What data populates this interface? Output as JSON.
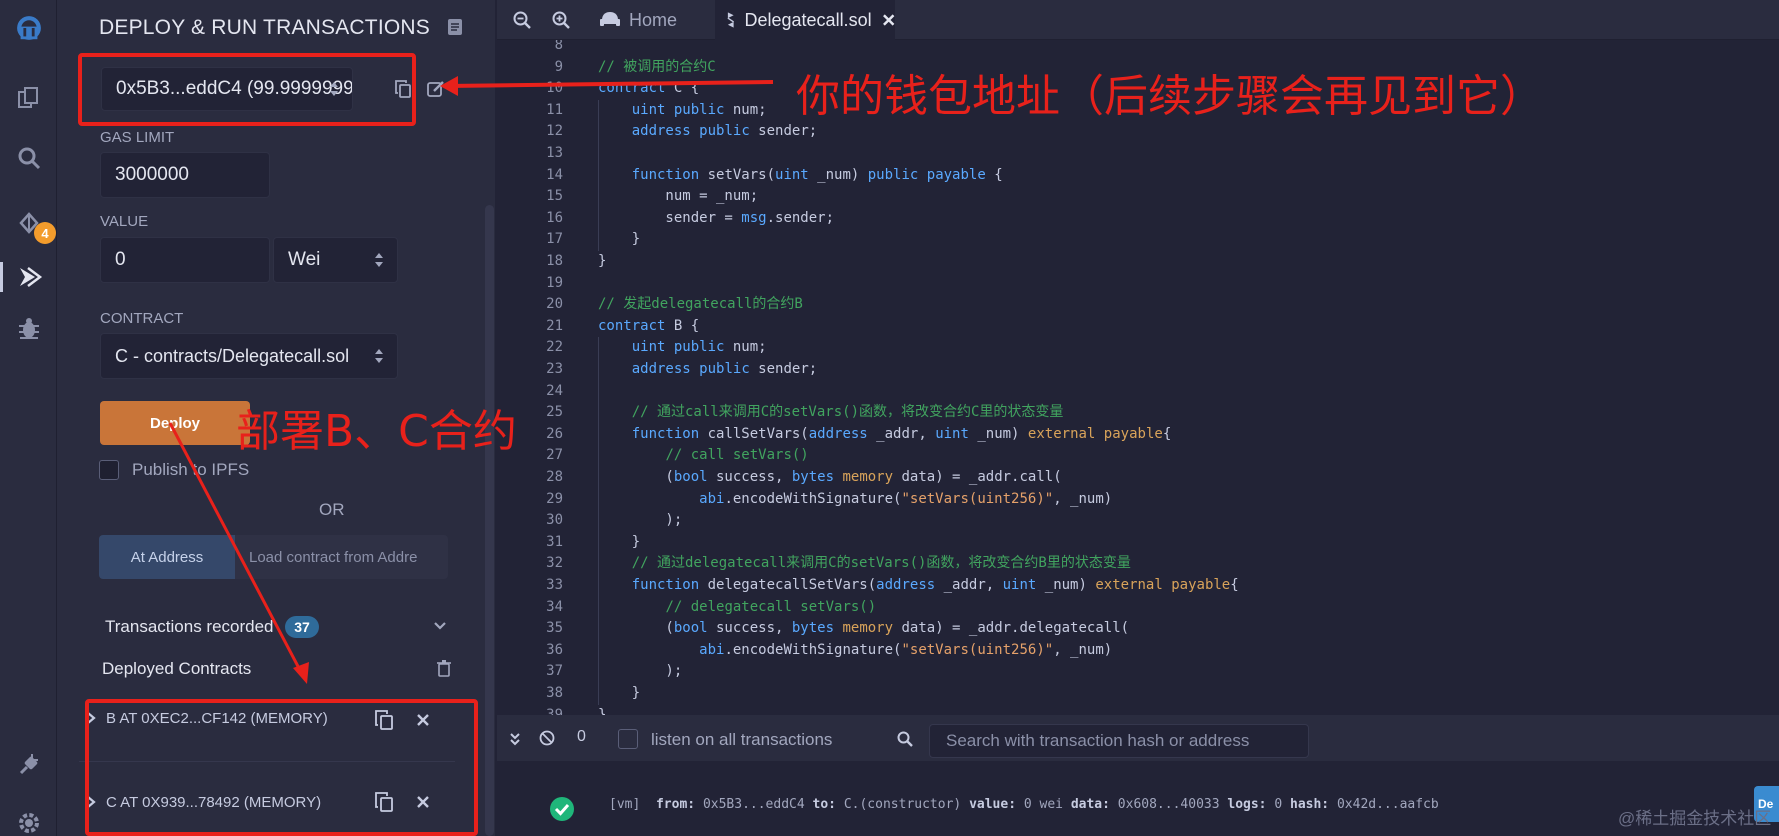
{
  "panel": {
    "title": "DEPLOY & RUN TRANSACTIONS",
    "account": "0x5B3...eddC4 (99.9999999",
    "gas_limit_label": "GAS LIMIT",
    "gas_limit_value": "3000000",
    "value_label": "VALUE",
    "value_value": "0",
    "value_unit": "Wei",
    "contract_label": "CONTRACT",
    "contract_value": "C - contracts/Delegatecall.sol",
    "deploy_label": "Deploy",
    "publish_label": "Publish to IPFS",
    "or_label": "OR",
    "at_address_label": "At Address",
    "at_address_placeholder": "Load contract from Addre",
    "transactions_label": "Transactions recorded",
    "transactions_count": "37",
    "deployed_label": "Deployed Contracts",
    "deployed": [
      {
        "label": "B AT 0XEC2...CF142 (MEMORY)"
      },
      {
        "label": "C AT 0X939...78492 (MEMORY)"
      }
    ]
  },
  "rail": {
    "badge": "4"
  },
  "tabs": [
    {
      "label": "Home"
    },
    {
      "label": "Delegatecall.sol"
    }
  ],
  "code": {
    "lines": [
      {
        "n": "8",
        "tokens": []
      },
      {
        "n": "9",
        "tokens": [
          {
            "c": "c",
            "t": "// 被调用的合约C"
          }
        ]
      },
      {
        "n": "10",
        "tokens": [
          {
            "c": "k",
            "t": "contract"
          },
          {
            "c": "p",
            "t": " C {"
          }
        ]
      },
      {
        "n": "11",
        "tokens": [
          {
            "c": "p",
            "t": "    "
          },
          {
            "c": "t",
            "t": "uint"
          },
          {
            "c": "p",
            "t": " "
          },
          {
            "c": "k",
            "t": "public"
          },
          {
            "c": "p",
            "t": " num;"
          }
        ]
      },
      {
        "n": "12",
        "tokens": [
          {
            "c": "p",
            "t": "    "
          },
          {
            "c": "t",
            "t": "address"
          },
          {
            "c": "p",
            "t": " "
          },
          {
            "c": "k",
            "t": "public"
          },
          {
            "c": "p",
            "t": " sender;"
          }
        ]
      },
      {
        "n": "13",
        "tokens": []
      },
      {
        "n": "14",
        "tokens": [
          {
            "c": "p",
            "t": "    "
          },
          {
            "c": "k",
            "t": "function"
          },
          {
            "c": "p",
            "t": " setVars("
          },
          {
            "c": "t",
            "t": "uint"
          },
          {
            "c": "p",
            "t": " _num) "
          },
          {
            "c": "k",
            "t": "public"
          },
          {
            "c": "p",
            "t": " "
          },
          {
            "c": "k",
            "t": "payable"
          },
          {
            "c": "p",
            "t": " {"
          }
        ]
      },
      {
        "n": "15",
        "tokens": [
          {
            "c": "p",
            "t": "        num = _num;"
          }
        ]
      },
      {
        "n": "16",
        "tokens": [
          {
            "c": "p",
            "t": "        sender = "
          },
          {
            "c": "k",
            "t": "msg"
          },
          {
            "c": "p",
            "t": ".sender;"
          }
        ]
      },
      {
        "n": "17",
        "tokens": [
          {
            "c": "p",
            "t": "    }"
          }
        ]
      },
      {
        "n": "18",
        "tokens": [
          {
            "c": "p",
            "t": "}"
          }
        ]
      },
      {
        "n": "19",
        "tokens": []
      },
      {
        "n": "20",
        "tokens": [
          {
            "c": "c",
            "t": "// 发起delegatecall的合约B"
          }
        ]
      },
      {
        "n": "21",
        "tokens": [
          {
            "c": "k",
            "t": "contract"
          },
          {
            "c": "p",
            "t": " B {"
          }
        ]
      },
      {
        "n": "22",
        "tokens": [
          {
            "c": "p",
            "t": "    "
          },
          {
            "c": "t",
            "t": "uint"
          },
          {
            "c": "p",
            "t": " "
          },
          {
            "c": "k",
            "t": "public"
          },
          {
            "c": "p",
            "t": " num;"
          }
        ]
      },
      {
        "n": "23",
        "tokens": [
          {
            "c": "p",
            "t": "    "
          },
          {
            "c": "t",
            "t": "address"
          },
          {
            "c": "p",
            "t": " "
          },
          {
            "c": "k",
            "t": "public"
          },
          {
            "c": "p",
            "t": " sender;"
          }
        ]
      },
      {
        "n": "24",
        "tokens": []
      },
      {
        "n": "25",
        "tokens": [
          {
            "c": "p",
            "t": "    "
          },
          {
            "c": "c",
            "t": "// 通过call来调用C的setVars()函数，将改变合约C里的状态变量"
          }
        ]
      },
      {
        "n": "26",
        "tokens": [
          {
            "c": "p",
            "t": "    "
          },
          {
            "c": "k",
            "t": "function"
          },
          {
            "c": "p",
            "t": " callSetVars("
          },
          {
            "c": "t",
            "t": "address"
          },
          {
            "c": "p",
            "t": " _addr, "
          },
          {
            "c": "t",
            "t": "uint"
          },
          {
            "c": "p",
            "t": " _num) "
          },
          {
            "c": "m",
            "t": "external"
          },
          {
            "c": "p",
            "t": " "
          },
          {
            "c": "m",
            "t": "payable"
          },
          {
            "c": "p",
            "t": "{"
          }
        ]
      },
      {
        "n": "27",
        "tokens": [
          {
            "c": "p",
            "t": "        "
          },
          {
            "c": "c",
            "t": "// call setVars()"
          }
        ]
      },
      {
        "n": "28",
        "tokens": [
          {
            "c": "p",
            "t": "        ("
          },
          {
            "c": "t",
            "t": "bool"
          },
          {
            "c": "p",
            "t": " success, "
          },
          {
            "c": "t",
            "t": "bytes"
          },
          {
            "c": "p",
            "t": " "
          },
          {
            "c": "m",
            "t": "memory"
          },
          {
            "c": "p",
            "t": " data) = _addr.call("
          }
        ]
      },
      {
        "n": "29",
        "tokens": [
          {
            "c": "p",
            "t": "            "
          },
          {
            "c": "k",
            "t": "abi"
          },
          {
            "c": "p",
            "t": ".encodeWithSignature("
          },
          {
            "c": "s",
            "t": "\"setVars(uint256)\""
          },
          {
            "c": "p",
            "t": ", _num)"
          }
        ]
      },
      {
        "n": "30",
        "tokens": [
          {
            "c": "p",
            "t": "        );"
          }
        ]
      },
      {
        "n": "31",
        "tokens": [
          {
            "c": "p",
            "t": "    }"
          }
        ]
      },
      {
        "n": "32",
        "tokens": [
          {
            "c": "p",
            "t": "    "
          },
          {
            "c": "c",
            "t": "// 通过delegatecall来调用C的setVars()函数，将改变合约B里的状态变量"
          }
        ]
      },
      {
        "n": "33",
        "tokens": [
          {
            "c": "p",
            "t": "    "
          },
          {
            "c": "k",
            "t": "function"
          },
          {
            "c": "p",
            "t": " delegatecallSetVars("
          },
          {
            "c": "t",
            "t": "address"
          },
          {
            "c": "p",
            "t": " _addr, "
          },
          {
            "c": "t",
            "t": "uint"
          },
          {
            "c": "p",
            "t": " _num) "
          },
          {
            "c": "m",
            "t": "external"
          },
          {
            "c": "p",
            "t": " "
          },
          {
            "c": "m",
            "t": "payable"
          },
          {
            "c": "p",
            "t": "{"
          }
        ]
      },
      {
        "n": "34",
        "tokens": [
          {
            "c": "p",
            "t": "        "
          },
          {
            "c": "c",
            "t": "// delegatecall setVars()"
          }
        ]
      },
      {
        "n": "35",
        "tokens": [
          {
            "c": "p",
            "t": "        ("
          },
          {
            "c": "t",
            "t": "bool"
          },
          {
            "c": "p",
            "t": " success, "
          },
          {
            "c": "t",
            "t": "bytes"
          },
          {
            "c": "p",
            "t": " "
          },
          {
            "c": "m",
            "t": "memory"
          },
          {
            "c": "p",
            "t": " data) = _addr.delegatecall("
          }
        ]
      },
      {
        "n": "36",
        "tokens": [
          {
            "c": "p",
            "t": "            "
          },
          {
            "c": "k",
            "t": "abi"
          },
          {
            "c": "p",
            "t": ".encodeWithSignature("
          },
          {
            "c": "s",
            "t": "\"setVars(uint256)\""
          },
          {
            "c": "p",
            "t": ", _num)"
          }
        ]
      },
      {
        "n": "37",
        "tokens": [
          {
            "c": "p",
            "t": "        );"
          }
        ]
      },
      {
        "n": "38",
        "tokens": [
          {
            "c": "p",
            "t": "    }"
          }
        ]
      },
      {
        "n": "39",
        "tokens": [
          {
            "c": "p",
            "t": "}"
          }
        ]
      }
    ]
  },
  "terminal": {
    "pending_count": "0",
    "listen_label": "listen on all transactions",
    "search_placeholder": "Search with transaction hash or address",
    "log_tag": "[vm]",
    "log_from_key": "from:",
    "log_from": "0x5B3...eddC4",
    "log_to_key": "to:",
    "log_to": "C.(constructor)",
    "log_value_key": "value:",
    "log_value": "0 wei",
    "log_data_key": "data:",
    "log_data": "0x608...40033",
    "log_logs_key": "logs:",
    "log_logs": "0",
    "log_hash_key": "hash:",
    "log_hash": "0x42d...aafcb",
    "debug_label": "De"
  },
  "annotations": {
    "wallet": "你的钱包地址（后续步骤会再见到它）",
    "deploy": "部署B、C合约"
  },
  "watermark": "@稀土掘金技术社区",
  "colors": {
    "accent_red": "#e8211b",
    "deploy_orange": "#c97539",
    "badge_orange": "#f39c2c",
    "success_green": "#1fb67a"
  }
}
